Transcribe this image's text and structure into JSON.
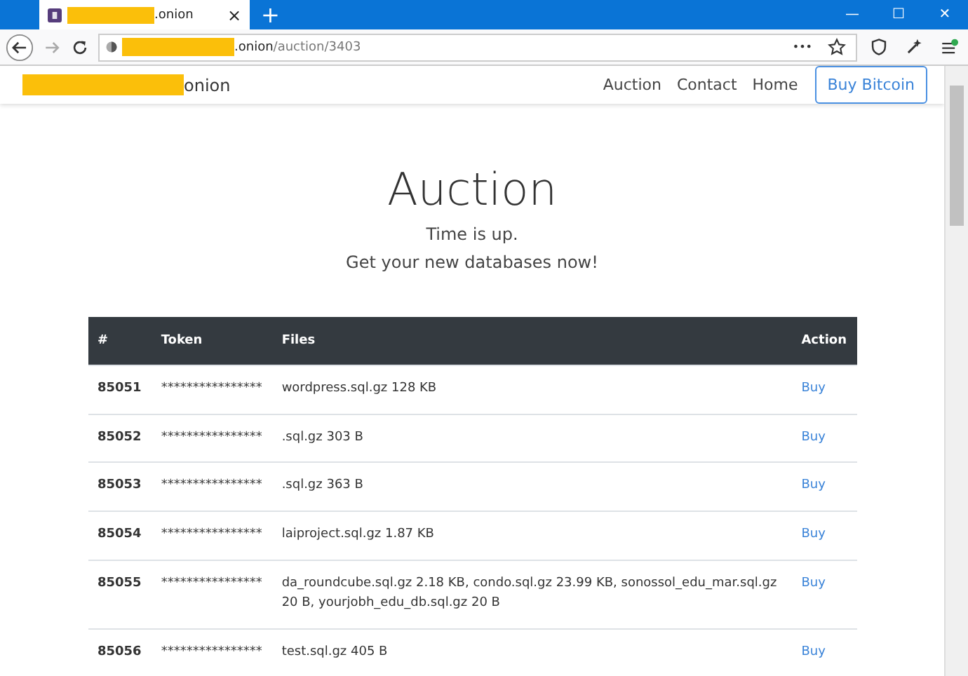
{
  "browser": {
    "tab": {
      "title": ".onion",
      "close": "×",
      "selected": true
    },
    "new_tab": "+",
    "window_controls": [
      "—",
      "☐",
      "✕"
    ],
    "address": {
      "host": ".onion",
      "path": "/auction/3403"
    },
    "page_actions": "•••"
  },
  "navbar": {
    "brand": "onion",
    "links": [
      {
        "label": "Auction"
      },
      {
        "label": "Contact"
      },
      {
        "label": "Home"
      }
    ],
    "button": "Buy Bitcoin"
  },
  "hero": {
    "title": "Auction",
    "lines": [
      "Time is up.",
      "Get your new databases now!"
    ]
  },
  "table": {
    "columns": [
      "#",
      "Token",
      "Files",
      "Action"
    ],
    "rows": [
      {
        "id": "85051",
        "token": "****************",
        "files": "wordpress.sql.gz 128 KB",
        "action": "Buy"
      },
      {
        "id": "85052",
        "token": "****************",
        "files": ".sql.gz 303 B",
        "action": "Buy"
      },
      {
        "id": "85053",
        "token": "****************",
        "files": ".sql.gz 363 B",
        "action": "Buy"
      },
      {
        "id": "85054",
        "token": "****************",
        "files": "laiproject.sql.gz 1.87 KB",
        "action": "Buy"
      },
      {
        "id": "85055",
        "token": "****************",
        "files": "da_roundcube.sql.gz 2.18 KB, condo.sql.gz 23.99 KB, sonossol_edu_mar.sql.gz 20 B, yourjobh_edu_db.sql.gz 20 B",
        "action": "Buy"
      },
      {
        "id": "85056",
        "token": "****************",
        "files": "test.sql.gz 405 B",
        "action": "Buy"
      }
    ]
  }
}
